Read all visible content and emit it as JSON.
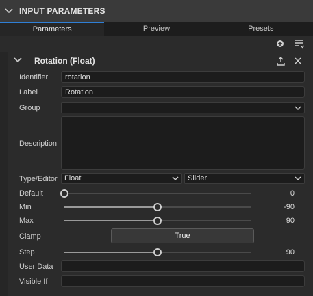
{
  "panel": {
    "title": "INPUT PARAMETERS"
  },
  "tabs": [
    {
      "label": "Parameters"
    },
    {
      "label": "Preview"
    },
    {
      "label": "Presets"
    }
  ],
  "toolbar": {
    "add_icon": "add-circle-icon",
    "menu_icon": "list-menu-icon"
  },
  "section": {
    "title": "Rotation (Float)",
    "export_icon": "export-icon",
    "close_icon": "close-icon"
  },
  "fields": {
    "identifier": {
      "label": "Identifier",
      "value": "rotation"
    },
    "label": {
      "label": "Label",
      "value": "Rotation"
    },
    "group": {
      "label": "Group",
      "value": ""
    },
    "description": {
      "label": "Description",
      "value": ""
    },
    "type_editor": {
      "label": "Type/Editor",
      "type": "Float",
      "editor": "Slider"
    },
    "default": {
      "label": "Default",
      "value": "0",
      "fraction": 0.0
    },
    "min": {
      "label": "Min",
      "value": "-90",
      "fraction": 0.5
    },
    "max": {
      "label": "Max",
      "value": "90",
      "fraction": 0.5
    },
    "clamp": {
      "label": "Clamp",
      "value": "True"
    },
    "step": {
      "label": "Step",
      "value": "90",
      "fraction": 0.5
    },
    "user_data": {
      "label": "User Data",
      "value": ""
    },
    "visible_if": {
      "label": "Visible If",
      "value": ""
    }
  },
  "colors": {
    "accent": "#2f7fd6",
    "background": "#2b2b2b",
    "field_bg": "#1c1c1c"
  }
}
